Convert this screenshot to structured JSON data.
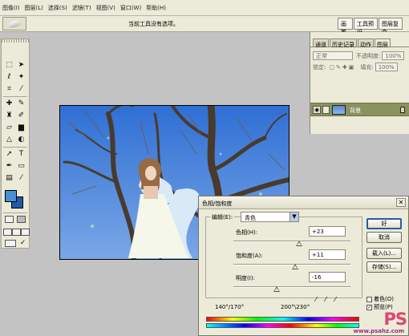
{
  "menubar": {
    "items": [
      "图像(I)",
      "图层(L)",
      "选择(S)",
      "滤镜(T)",
      "视图(V)",
      "窗口(W)",
      "帮助(H)"
    ]
  },
  "options": {
    "hint": "当前工具没有选项。"
  },
  "dock": {
    "tabs": [
      "画笔",
      "工具预设",
      "图层复合"
    ]
  },
  "layers_panel": {
    "tabs": [
      "通道",
      "历史记录",
      "动作",
      "图层"
    ],
    "blend_mode": "正常",
    "opacity_label": "不透明度:",
    "opacity_value": "100%",
    "lock_label": "锁定:",
    "fill_label": "填充:",
    "fill_value": "100%",
    "layer_name": "背景"
  },
  "toolbox": {
    "foreground_color": "#4a8fd4",
    "background_color": "#1d5aa8",
    "tool_icons": [
      "marquee-icon",
      "move-icon",
      "lasso-icon",
      "magic-wand-icon",
      "crop-icon",
      "slice-icon",
      "healing-icon",
      "brush-icon",
      "stamp-icon",
      "history-brush-icon",
      "eraser-icon",
      "gradient-icon",
      "blur-icon",
      "dodge-icon",
      "path-select-icon",
      "type-icon",
      "pen-icon",
      "shape-icon",
      "notes-icon",
      "eyedropper-icon",
      "hand-icon",
      "zoom-icon"
    ]
  },
  "dialog": {
    "title": "色相/饱和度",
    "edit_label": "编辑(E):",
    "edit_value": "青色",
    "hue_label": "色相(H):",
    "hue_value": "+23",
    "hue_pos": 0.56,
    "sat_label": "饱和度(A):",
    "sat_value": "+11",
    "sat_pos": 0.53,
    "light_label": "明度(I):",
    "light_value": "-16",
    "light_pos": 0.37,
    "ok_label": "好",
    "cancel_label": "取消",
    "load_label": "载入(L)...",
    "save_label": "存储(S)...",
    "colorize_label": "着色(O)",
    "preview_label": "预览(P)",
    "range_left": "140°/170°",
    "range_right": "200°\\230°"
  },
  "watermark": {
    "logo": "PS",
    "site": "www.psahz.com"
  }
}
